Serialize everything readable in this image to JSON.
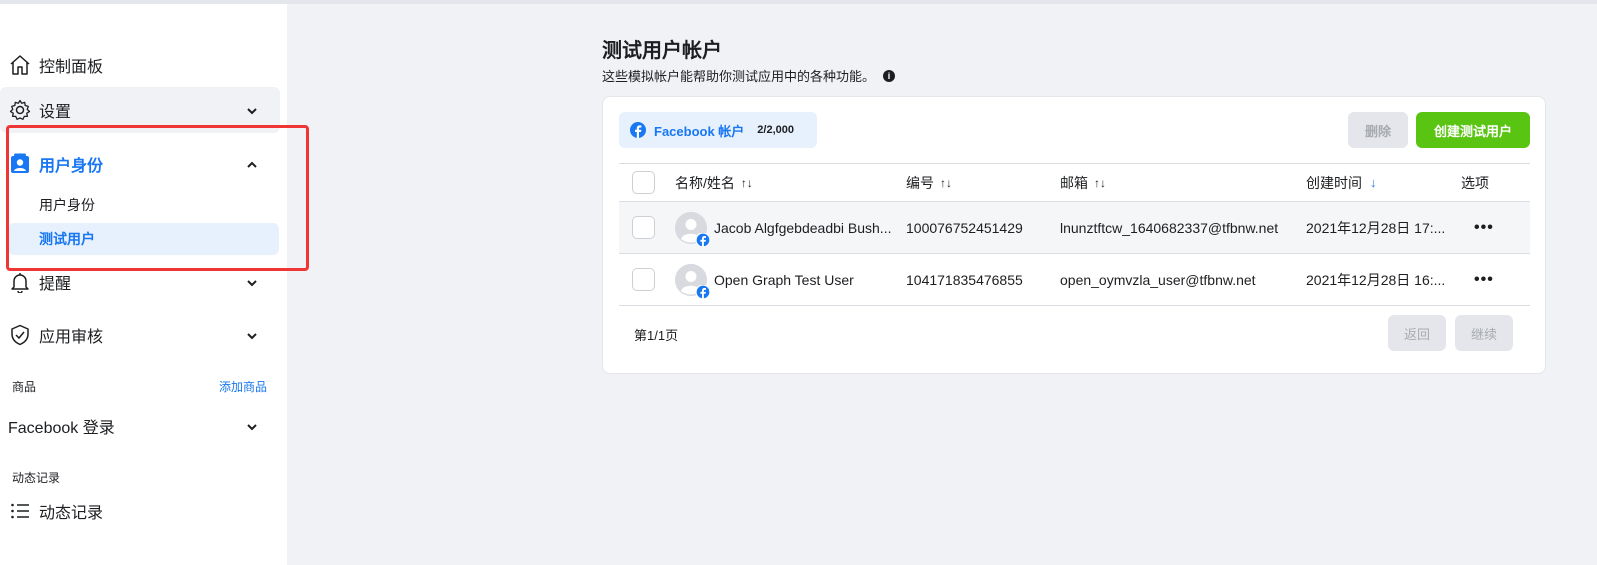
{
  "sidebar": {
    "dashboard": "控制面板",
    "settings": "设置",
    "roles": "用户身份",
    "roles_sub": [
      "用户身份",
      "测试用户"
    ],
    "alerts": "提醒",
    "app_review": "应用审核",
    "products_label": "商品",
    "add_product": "添加商品",
    "facebook_login": "Facebook 登录",
    "activity_label": "动态记录",
    "activity": "动态记录"
  },
  "main": {
    "title": "测试用户帐户",
    "subtitle": "这些模拟帐户能帮助你测试应用中的各种功能。",
    "tab_label": "Facebook 帐户",
    "tab_count": "2/2,000",
    "delete_button": "删除",
    "create_button": "创建测试用户",
    "columns": {
      "name": "名称/姓名",
      "id": "编号",
      "email": "邮箱",
      "created": "创建时间",
      "options": "选项"
    },
    "rows": [
      {
        "name": "Jacob Algfgebdeadbi Bush...",
        "id": "100076752451429",
        "email": "lnunztftcw_1640682337@tfbnw.net",
        "created": "2021年12月28日 17:..."
      },
      {
        "name": "Open Graph Test User",
        "id": "104171835476855",
        "email": "open_oymvzla_user@tfbnw.net",
        "created": "2021年12月28日 16:..."
      }
    ],
    "page_info": "第1/1页",
    "back_button": "返回",
    "next_button": "继续"
  },
  "colors": {
    "accent": "#1877f2",
    "create": "#5ac413",
    "highlight": "#f03535"
  }
}
